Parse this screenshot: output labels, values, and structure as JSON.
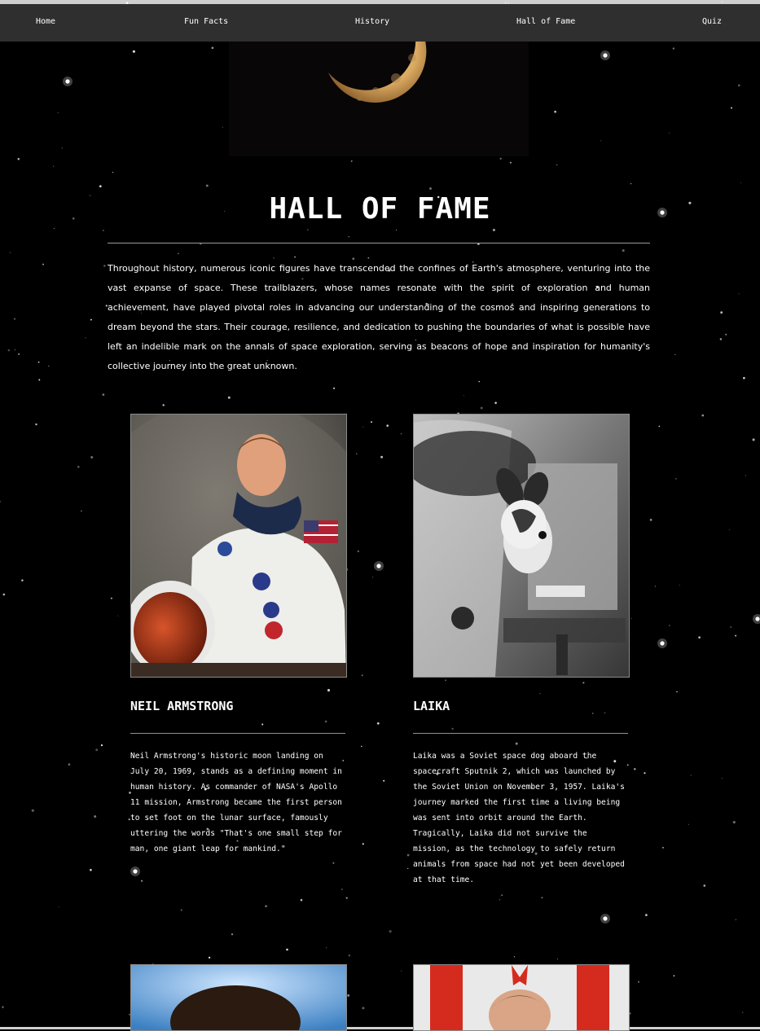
{
  "nav": {
    "home": "Home",
    "fun_facts": "Fun Facts",
    "history": "History",
    "hall_of_fame": "Hall of Fame",
    "quiz": "Quiz"
  },
  "page": {
    "title": "HALL OF FAME",
    "intro": "Throughout history, numerous iconic figures have transcended the confines of Earth's atmosphere, venturing into the vast expanse of space. These trailblazers, whose names resonate with the spirit of exploration and human achievement, have played pivotal roles in advancing our understanding of the cosmos and inspiring generations to dream beyond the stars. Their courage, resilience, and dedication to pushing the boundaries of what is possible have left an indelible mark on the annals of space exploration, serving as beacons of hope and inspiration for humanity's collective journey into the great unknown."
  },
  "cards": [
    {
      "name": "NEIL ARMSTRONG",
      "bio": "Neil Armstrong's historic moon landing on July 20, 1969, stands as a defining moment in human history. As commander of NASA's Apollo 11 mission, Armstrong became the first person to set foot on the lunar surface, famously uttering the words \"That's one small step for man, one giant leap for mankind.\""
    },
    {
      "name": "LAIKA",
      "bio": "Laika was a Soviet space dog aboard the spacecraft Sputnik 2, which was launched by the Soviet Union on November 3, 1957. Laika's journey marked the first time a living being was sent into orbit around the Earth. Tragically, Laika did not survive the mission, as the technology to safely return animals from space had not yet been developed at that time."
    }
  ]
}
